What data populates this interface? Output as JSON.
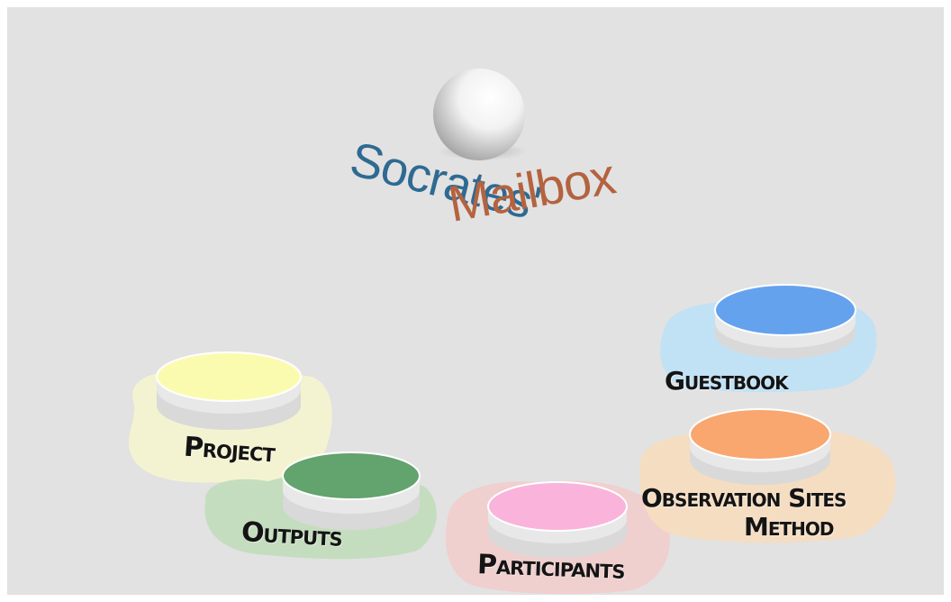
{
  "logo": {
    "line1": "Socrates'",
    "line2": "Mailbox",
    "colors": {
      "line1": "#2e6a92",
      "line2": "#b4633f"
    }
  },
  "nav": {
    "project": {
      "label": "Project",
      "disc_color": "#fbfbb0",
      "splash_color": "#f6f5cf"
    },
    "outputs": {
      "label": "Outputs",
      "disc_color": "#63a36d",
      "splash_color": "#c2dcbc"
    },
    "participants": {
      "label": "Participants",
      "disc_color": "#fab4dc",
      "splash_color": "#f2cdcd"
    },
    "guestbook": {
      "label": "Guestbook",
      "disc_color": "#65a2ee",
      "splash_color": "#bfe0f6"
    },
    "observation": {
      "label_line1": "Observation Sites",
      "label_line2": "Method",
      "disc_color": "#f9a66f",
      "splash_color": "#f6dcc0"
    }
  }
}
